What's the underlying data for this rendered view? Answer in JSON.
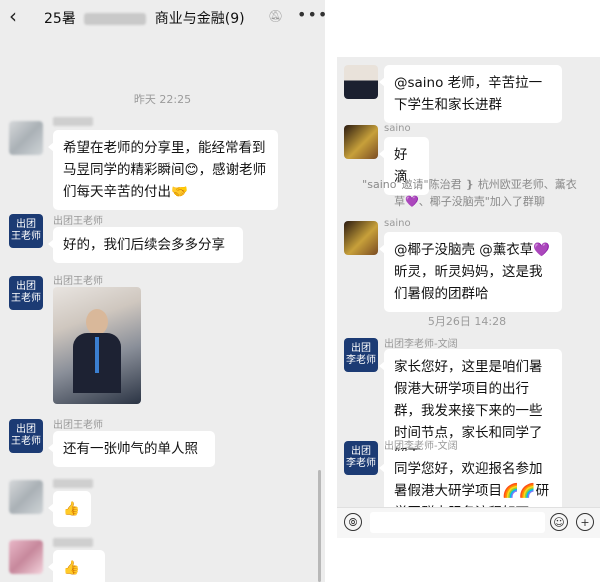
{
  "left": {
    "header": {
      "back_icon": "chevron-left-icon",
      "title_prefix": "25暑",
      "title_suffix": "商业与金融(9)",
      "mute_icon": "bell-muted-icon",
      "more_icon": "more-icon"
    },
    "timestamp": "昨天 22:25",
    "messages": [
      {
        "text": "希望在老师的分享里，能经常看到马昱同学的精彩瞬间😊，感谢老师们每天辛苦的付出🤝"
      },
      {
        "sender": "出团王老师",
        "text": "好的，我们后续会多多分享"
      },
      {
        "sender": "出团王老师",
        "type": "image"
      },
      {
        "sender": "出团王老师",
        "text": "还有一张帅气的单人照"
      },
      {
        "text": "👍"
      },
      {
        "text": "👍👍"
      }
    ],
    "avatar_brand_line1": "出团",
    "avatar_brand_line2": "王老师"
  },
  "right": {
    "messages": [
      {
        "text": "@saino 老师，辛苦拉一下学生和家长进群"
      },
      {
        "sender": "saino",
        "text": "好滴"
      }
    ],
    "system_line1_a": "\"saino\"邀请\"陈治君",
    "system_line1_b": "杭州欧亚老师、薰衣",
    "system_line2": "草💜、椰子没脑壳\"加入了群聊",
    "msg3_sender": "saino",
    "msg3_text": "@椰子没脑壳 @薰衣草💜 昕灵，昕灵妈妈，这是我们暑假的团群哈",
    "timestamp": "5月26日 14:28",
    "msg4_sender": "出团李老师-文阔",
    "msg4_text": "家长您好，这里是咱们暑假港大研学项目的出行群，我发来接下来的一些时间节点，家长和同学了解下",
    "msg5_sender": "出团李老师-文阔",
    "msg5_text": "同学您好，欢迎报名参加暑假港大研学项目🌈🌈研学团群内服务流程如下：",
    "avatar_brand_line1": "出团",
    "avatar_brand_line2": "李老师",
    "input": {
      "voice_icon": "voice-icon",
      "emoji_icon": "emoji-icon",
      "plus_icon": "plus-icon"
    }
  }
}
